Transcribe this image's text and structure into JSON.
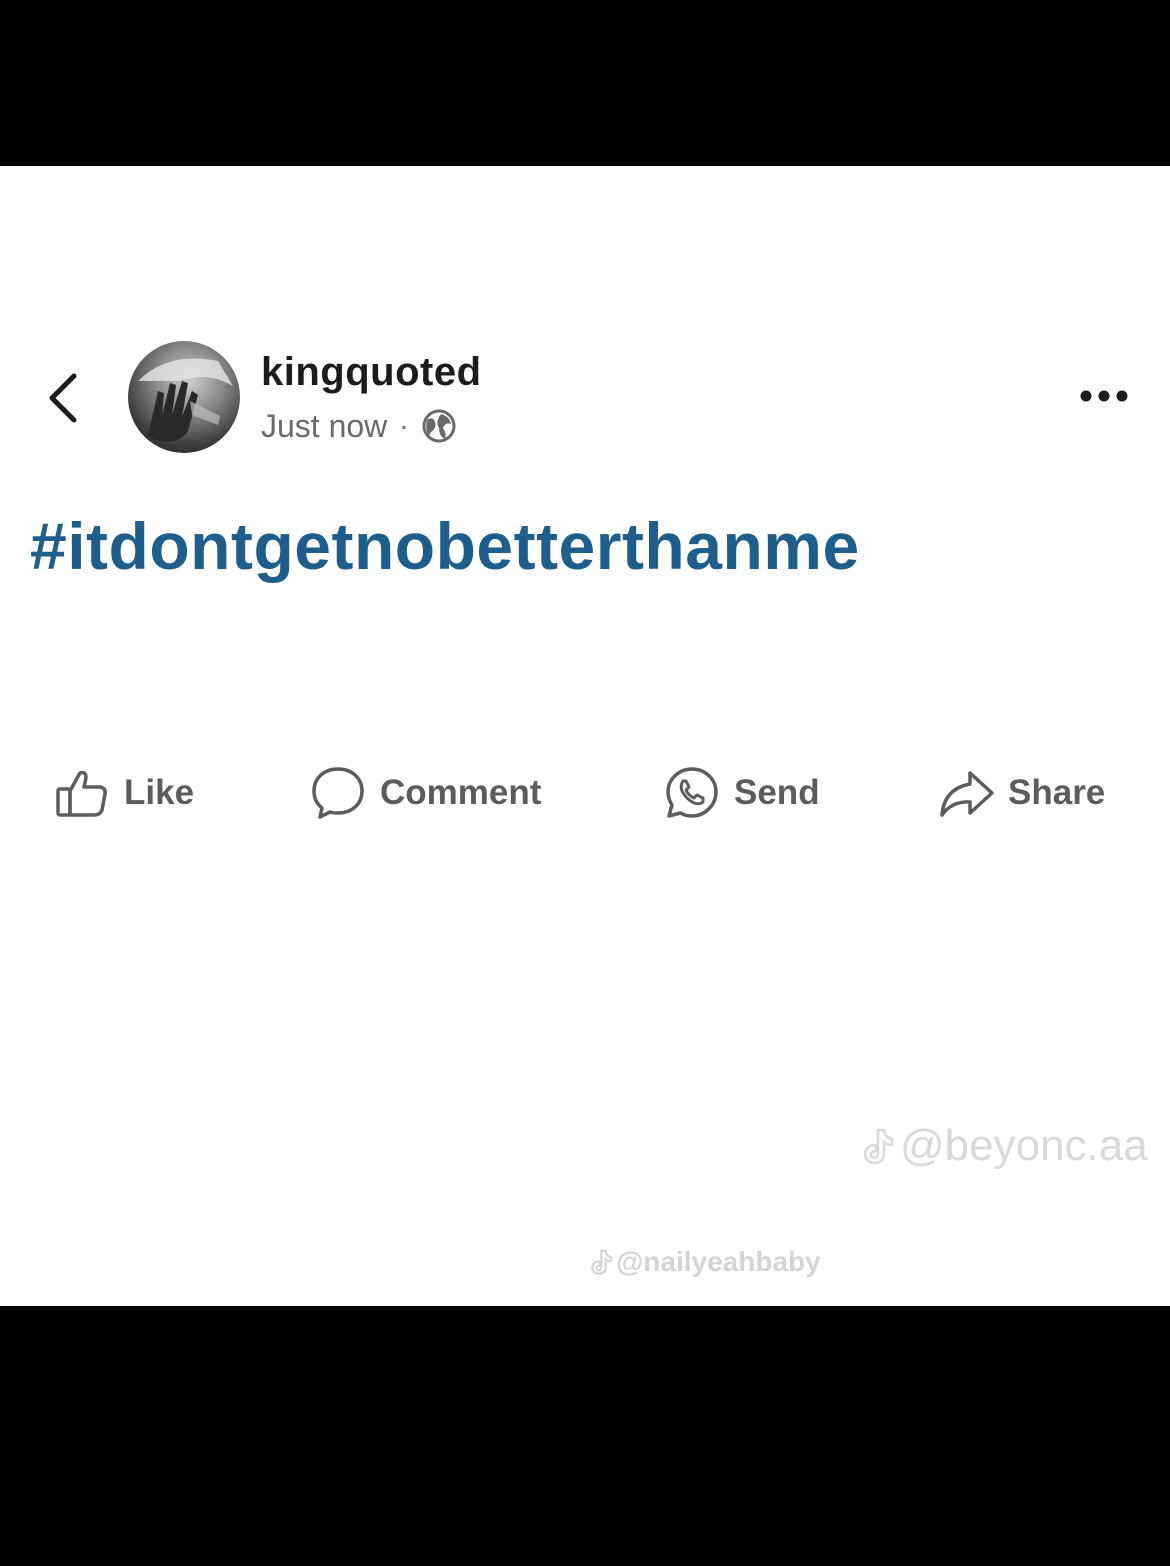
{
  "post": {
    "username": "kingquoted",
    "timestamp": "Just now",
    "separator": "·",
    "privacy_icon": "globe-icon",
    "hashtag": "#itdontgetnobetterthanme"
  },
  "actions": {
    "like": "Like",
    "comment": "Comment",
    "send": "Send",
    "share": "Share"
  },
  "watermarks": {
    "primary": "@beyonc.aa",
    "secondary": "@nailyeahbaby"
  },
  "colors": {
    "hashtag": "#1d5e8c",
    "background": "#ffffff",
    "letterbox": "#000000"
  }
}
